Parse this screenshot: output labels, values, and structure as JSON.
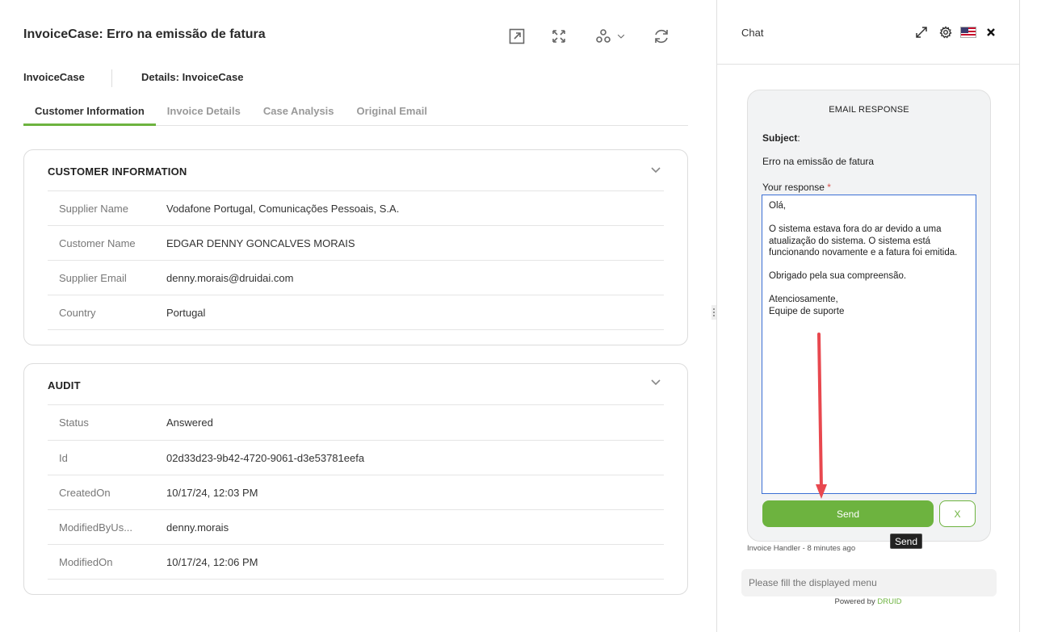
{
  "main": {
    "title": "InvoiceCase: Erro na emissão de fatura",
    "toolbar": {
      "icons": [
        "open-external-icon",
        "expand-icon",
        "flow-icon",
        "refresh-icon"
      ]
    },
    "subheader": {
      "entity": "InvoiceCase",
      "details": "Details: InvoiceCase"
    },
    "tabs": [
      {
        "label": "Customer Information",
        "active": true
      },
      {
        "label": "Invoice Details",
        "active": false
      },
      {
        "label": "Case Analysis",
        "active": false
      },
      {
        "label": "Original Email",
        "active": false
      }
    ],
    "customer_card": {
      "title": "CUSTOMER INFORMATION",
      "rows": [
        {
          "label": "Supplier Name",
          "value": "Vodafone Portugal, Comunicações Pessoais, S.A."
        },
        {
          "label": "Customer Name",
          "value": "EDGAR DENNY GONCALVES MORAIS"
        },
        {
          "label": "Supplier Email",
          "value": "denny.morais@druidai.com"
        },
        {
          "label": "Country",
          "value": "Portugal"
        }
      ]
    },
    "audit_card": {
      "title": "AUDIT",
      "rows": [
        {
          "label": "Status",
          "value": "Answered"
        },
        {
          "label": "Id",
          "value": "02d33d23-9b42-4720-9061-d3e53781eefa"
        },
        {
          "label": "CreatedOn",
          "value": "10/17/24, 12:03 PM"
        },
        {
          "label": "ModifiedByUs...",
          "value": "denny.morais"
        },
        {
          "label": "ModifiedOn",
          "value": "10/17/24, 12:06 PM"
        }
      ]
    }
  },
  "chat": {
    "title": "Chat",
    "bubble": {
      "title": "EMAIL RESPONSE",
      "subject_label": "Subject",
      "subject_value": "Erro na emissão de fatura",
      "response_label": "Your response",
      "required_mark": "*",
      "response_text": "Olá,\n\nO sistema estava fora do ar devido a uma atualização do sistema. O sistema está funcionando novamente e a fatura foi emitida.\n\nObrigado pela sua compreensão.\n\nAtenciosamente,\nEquipe de suporte",
      "send_label": "Send",
      "cancel_label": "X"
    },
    "tooltip": "Send",
    "meta": "Invoice Handler - 8 minutes ago",
    "input_placeholder": "Please fill the displayed menu",
    "powered_prefix": "Powered by",
    "powered_brand": "DRUID",
    "colors": {
      "accent": "#6db33f",
      "annotation_arrow": "#e8484f",
      "focus_border": "#3b6fd4"
    }
  }
}
